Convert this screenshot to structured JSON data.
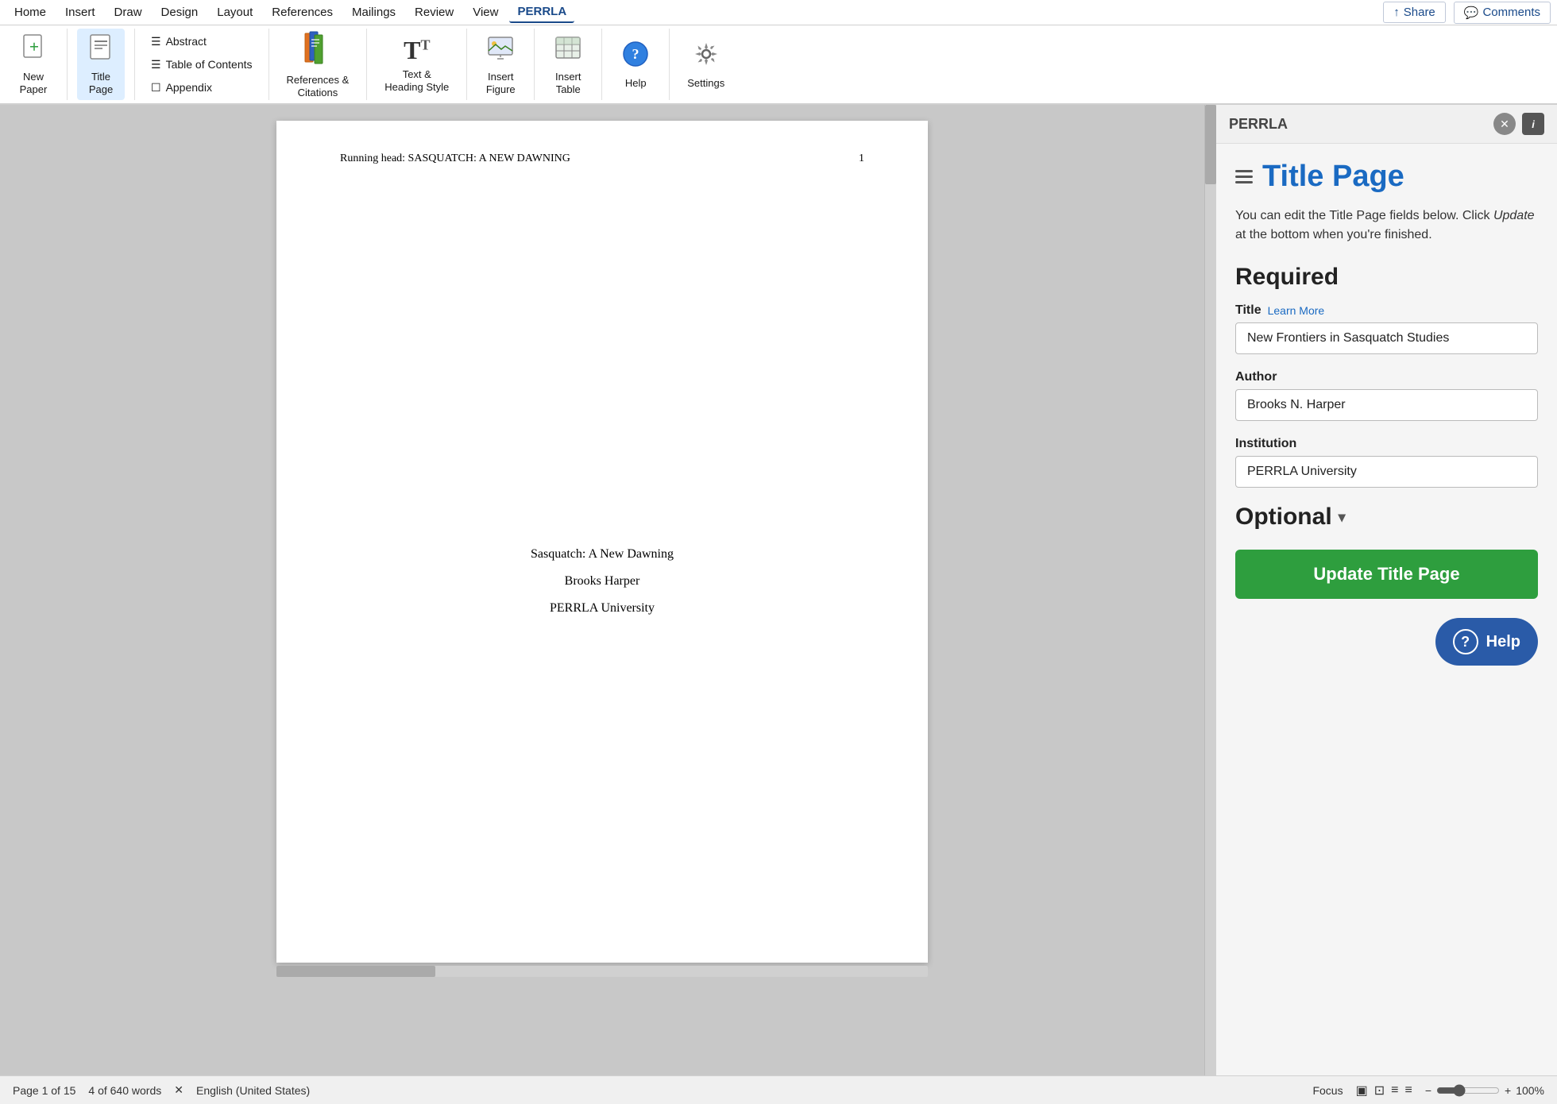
{
  "menubar": {
    "items": [
      "Home",
      "Insert",
      "Draw",
      "Design",
      "Layout",
      "References",
      "Mailings",
      "Review",
      "View",
      "PERRLA"
    ],
    "active": "PERRLA",
    "share_label": "Share",
    "comments_label": "Comments"
  },
  "ribbon": {
    "groups": [
      {
        "name": "new-paper-group",
        "buttons": [
          {
            "id": "new-paper",
            "label": "New\nPaper",
            "icon": "📄"
          }
        ]
      },
      {
        "name": "title-page-group",
        "buttons": [
          {
            "id": "title-page",
            "label": "Title\nPage",
            "icon": "📋"
          }
        ]
      },
      {
        "name": "abstract-group",
        "stackItems": [
          {
            "id": "abstract",
            "label": "Abstract",
            "icon": "☰"
          },
          {
            "id": "table-of-contents",
            "label": "Table of Contents",
            "icon": "☰"
          },
          {
            "id": "appendix",
            "label": "Appendix",
            "icon": "☐"
          }
        ]
      },
      {
        "name": "references-group",
        "buttons": [
          {
            "id": "references-citations",
            "label": "References &\nCitations",
            "icon": "📚"
          }
        ]
      },
      {
        "name": "text-style-group",
        "buttons": [
          {
            "id": "text-heading-style",
            "label": "Text &\nHeading Style",
            "icon": "T"
          }
        ]
      },
      {
        "name": "insert-figure-group",
        "buttons": [
          {
            "id": "insert-figure",
            "label": "Insert\nFigure",
            "icon": "🖼"
          }
        ]
      },
      {
        "name": "insert-table-group",
        "buttons": [
          {
            "id": "insert-table",
            "label": "Insert\nTable",
            "icon": "⊞"
          }
        ]
      },
      {
        "name": "help-group",
        "buttons": [
          {
            "id": "help",
            "label": "Help",
            "icon": "?"
          }
        ]
      },
      {
        "name": "settings-group",
        "buttons": [
          {
            "id": "settings",
            "label": "Settings",
            "icon": "⚙"
          }
        ]
      }
    ]
  },
  "document": {
    "running_head": "Running head: SASQUATCH: A NEW DAWNING",
    "page_number": "1",
    "title": "Sasquatch: A New Dawning",
    "author": "Brooks Harper",
    "institution": "PERRLA University"
  },
  "panel": {
    "title": "PERRLA",
    "section": "Title Page",
    "description_part1": "You can edit the Title Page fields below. Click ",
    "description_italic": "Update",
    "description_part2": " at the bottom when you're finished.",
    "required_heading": "Required",
    "fields": {
      "title_label": "Title",
      "title_learn_more": "Learn More",
      "title_value": "New Frontiers in Sasquatch Studies",
      "author_label": "Author",
      "author_value": "Brooks N. Harper",
      "institution_label": "Institution",
      "institution_value": "PERRLA University"
    },
    "optional_label": "Optional",
    "update_button": "Update Title Page",
    "help_button": "Help"
  },
  "statusbar": {
    "page_info": "Page 1 of 15",
    "word_count": "4 of 640 words",
    "language": "English (United States)",
    "focus_label": "Focus",
    "zoom_level": "100%"
  }
}
